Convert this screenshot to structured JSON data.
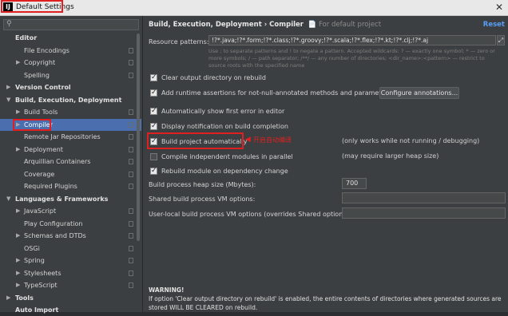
{
  "window": {
    "title": "Default Settings",
    "app_icon": "IJ"
  },
  "sidebar": {
    "search_placeholder": "",
    "items": [
      {
        "label": "Editor",
        "bold": true,
        "arrow": "",
        "indent": 0
      },
      {
        "label": "File Encodings",
        "bold": false,
        "arrow": "",
        "indent": 1
      },
      {
        "label": "Copyright",
        "bold": false,
        "arrow": "▶",
        "indent": 1
      },
      {
        "label": "Spelling",
        "bold": false,
        "arrow": "",
        "indent": 1
      },
      {
        "label": "Version Control",
        "bold": true,
        "arrow": "▶",
        "indent": 0
      },
      {
        "label": "Build, Execution, Deployment",
        "bold": true,
        "arrow": "▼",
        "indent": 0
      },
      {
        "label": "Build Tools",
        "bold": false,
        "arrow": "▶",
        "indent": 1
      },
      {
        "label": "Compiler",
        "bold": false,
        "arrow": "▶",
        "indent": 1,
        "selected": true
      },
      {
        "label": "Remote Jar Repositories",
        "bold": false,
        "arrow": "",
        "indent": 1
      },
      {
        "label": "Deployment",
        "bold": false,
        "arrow": "▶",
        "indent": 1
      },
      {
        "label": "Arquillian Containers",
        "bold": false,
        "arrow": "",
        "indent": 1
      },
      {
        "label": "Coverage",
        "bold": false,
        "arrow": "",
        "indent": 1
      },
      {
        "label": "Required Plugins",
        "bold": false,
        "arrow": "",
        "indent": 1
      },
      {
        "label": "Languages & Frameworks",
        "bold": true,
        "arrow": "▼",
        "indent": 0
      },
      {
        "label": "JavaScript",
        "bold": false,
        "arrow": "▶",
        "indent": 1
      },
      {
        "label": "Play Configuration",
        "bold": false,
        "arrow": "",
        "indent": 1
      },
      {
        "label": "Schemas and DTDs",
        "bold": false,
        "arrow": "▶",
        "indent": 1
      },
      {
        "label": "OSGi",
        "bold": false,
        "arrow": "",
        "indent": 1
      },
      {
        "label": "Spring",
        "bold": false,
        "arrow": "▶",
        "indent": 1
      },
      {
        "label": "Stylesheets",
        "bold": false,
        "arrow": "▶",
        "indent": 1
      },
      {
        "label": "TypeScript",
        "bold": false,
        "arrow": "▶",
        "indent": 1
      },
      {
        "label": "Tools",
        "bold": true,
        "arrow": "▶",
        "indent": 0
      },
      {
        "label": "Auto Import",
        "bold": true,
        "arrow": "",
        "indent": 0
      }
    ]
  },
  "main": {
    "breadcrumb": "Build, Execution, Deployment › Compiler",
    "breadcrumb_sub": "For default project",
    "reset_label": "Reset",
    "resource_patterns_label": "Resource patterns:",
    "resource_patterns_value": "!?*.java;!?*.form;!?*.class;!?*.groovy;!?*.scala;!?*.flex;!?*.kt;!?*.clj;!?*.aj",
    "resource_hint": "Use ; to separate patterns and ! to negate a pattern. Accepted wildcards: ? — exactly one symbol; * — zero or more symbols; / — path separator; /**/ — any number of directories; <dir_name>:<pattern> — restrict to source roots with the specified name",
    "options": [
      {
        "label": "Clear output directory on rebuild",
        "checked": true
      },
      {
        "label": "Add runtime assertions for not-null-annotated methods and parameters",
        "checked": true
      },
      {
        "label": "Automatically show first error in editor",
        "checked": true
      },
      {
        "label": "Display notification on build completion",
        "checked": true
      },
      {
        "label": "Build project automatically",
        "checked": true
      },
      {
        "label": "Compile independent modules in parallel",
        "checked": false
      },
      {
        "label": "Rebuild module on dependency change",
        "checked": true
      }
    ],
    "configure_annotations_label": "Configure annotations...",
    "annotation_text": "开启自动编译",
    "note_build_auto": "(only works while not running / debugging)",
    "note_parallel": "(may require larger heap size)",
    "heap_size_label": "Build process heap size (Mbytes):",
    "heap_size_value": "700",
    "shared_vm_label": "Shared build process VM options:",
    "shared_vm_value": "",
    "user_vm_label": "User-local build process VM options (overrides Shared options):",
    "user_vm_value": "",
    "warning_title": "WARNING!",
    "warning_text": "If option 'Clear output directory on rebuild' is enabled, the entire contents of directories where generated sources are stored WILL BE CLEARED on rebuild.",
    "colors": {
      "selection": "#4b6eaf",
      "highlight": "#e02020",
      "link": "#589df6"
    }
  }
}
